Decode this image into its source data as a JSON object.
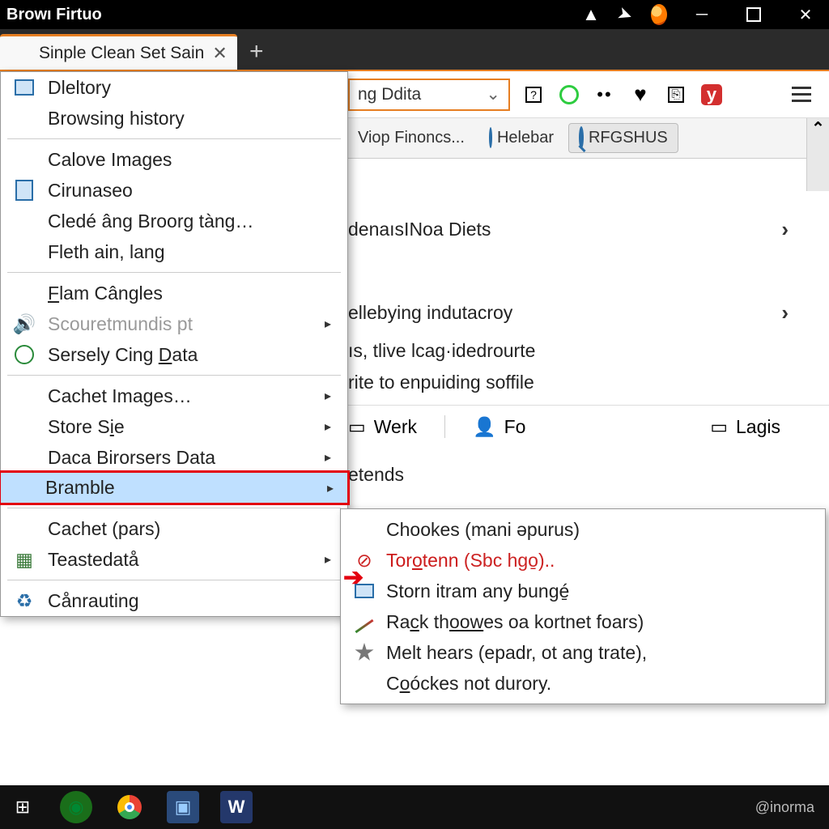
{
  "window_title": "Browı Firtuo",
  "tab": {
    "label": "Sinple Clean Set Sain",
    "icon": "firefox-logo"
  },
  "toolbar": {
    "addr_text": "ng Ddita",
    "icons": [
      "help-icon",
      "refresh-ring-icon",
      "dots-icon",
      "heart-icon",
      "clipboard-icon",
      "y-box-icon",
      "hamburger-icon"
    ]
  },
  "bookmarks": [
    {
      "label": "Viop Finoncs...",
      "icon": ""
    },
    {
      "label": "Helebar",
      "icon": "globe-icon"
    },
    {
      "label": "RFGSHUS",
      "icon": "search-icon",
      "active": true
    }
  ],
  "content": {
    "row1": "denaısINoa Diets",
    "row2": "ellebying indutacroy",
    "line3": "ıs, tlive lcag·idedrourte",
    "line4": "rite to enpuiding soffile",
    "row5": "etends",
    "tools": [
      {
        "label": "Werk",
        "icon": "panel-icon"
      },
      {
        "label": "Fo",
        "icon": "person-icon"
      },
      {
        "label": "Lagis",
        "icon": "panel-icon"
      }
    ]
  },
  "menu": {
    "group1": [
      {
        "label": "Dleltory",
        "icon": "display-icon"
      },
      {
        "label": "Browsing history"
      }
    ],
    "group2": [
      {
        "label": "Calove Images"
      },
      {
        "label": "Cirunaseo",
        "icon": "document-icon"
      },
      {
        "label": "Cledé âng Broorg tàng…"
      },
      {
        "label": "Fleth ain, lang"
      }
    ],
    "group3": [
      {
        "label_html": "<u>F</u>lam Cângles"
      },
      {
        "label": "Scouretmundis pt",
        "icon": "speaker-icon",
        "disabled": true,
        "submenu": true
      },
      {
        "label_html": "Sersely Cing <u>D</u>ata",
        "icon": "globe-sync-icon"
      }
    ],
    "group4": [
      {
        "label": "Cachet Images…",
        "submenu": true
      },
      {
        "label_html": "Store S<u>i</u>e",
        "submenu": true
      },
      {
        "label": "Daca Birorsers Data",
        "submenu": true
      }
    ],
    "highlight": {
      "label": "Bramble",
      "submenu": true
    },
    "group5": [
      {
        "label": "Cachet (pars)"
      },
      {
        "label": "Teastedatå",
        "icon": "grid-icon",
        "submenu": true
      }
    ],
    "group6": [
      {
        "label": "Cånrauting",
        "icon": "recycle-icon"
      }
    ]
  },
  "submenu": [
    {
      "label": "Chookes (mani əpurus)"
    },
    {
      "label_html": "Tor<u>o</u>tenn (Sbc hgo̱)..",
      "icon": "stop-icon",
      "danger": true
    },
    {
      "label": "Storn itram any bungé̱",
      "icon": "panel-blue-icon"
    },
    {
      "label_html": "Ra<u>c</u>k th<u>oow</u>es oa kortnet foars)",
      "icon": "pencil-icon"
    },
    {
      "label": "Melt hears (epadr, ot ang trate),",
      "icon": "star-grey-icon"
    },
    {
      "label_html": "C<u>o</u>óckes not durory."
    }
  ],
  "taskbar": {
    "items": [
      "windows-start",
      "app1",
      "chrome",
      "app2",
      "app3"
    ],
    "right": "@inorma"
  }
}
